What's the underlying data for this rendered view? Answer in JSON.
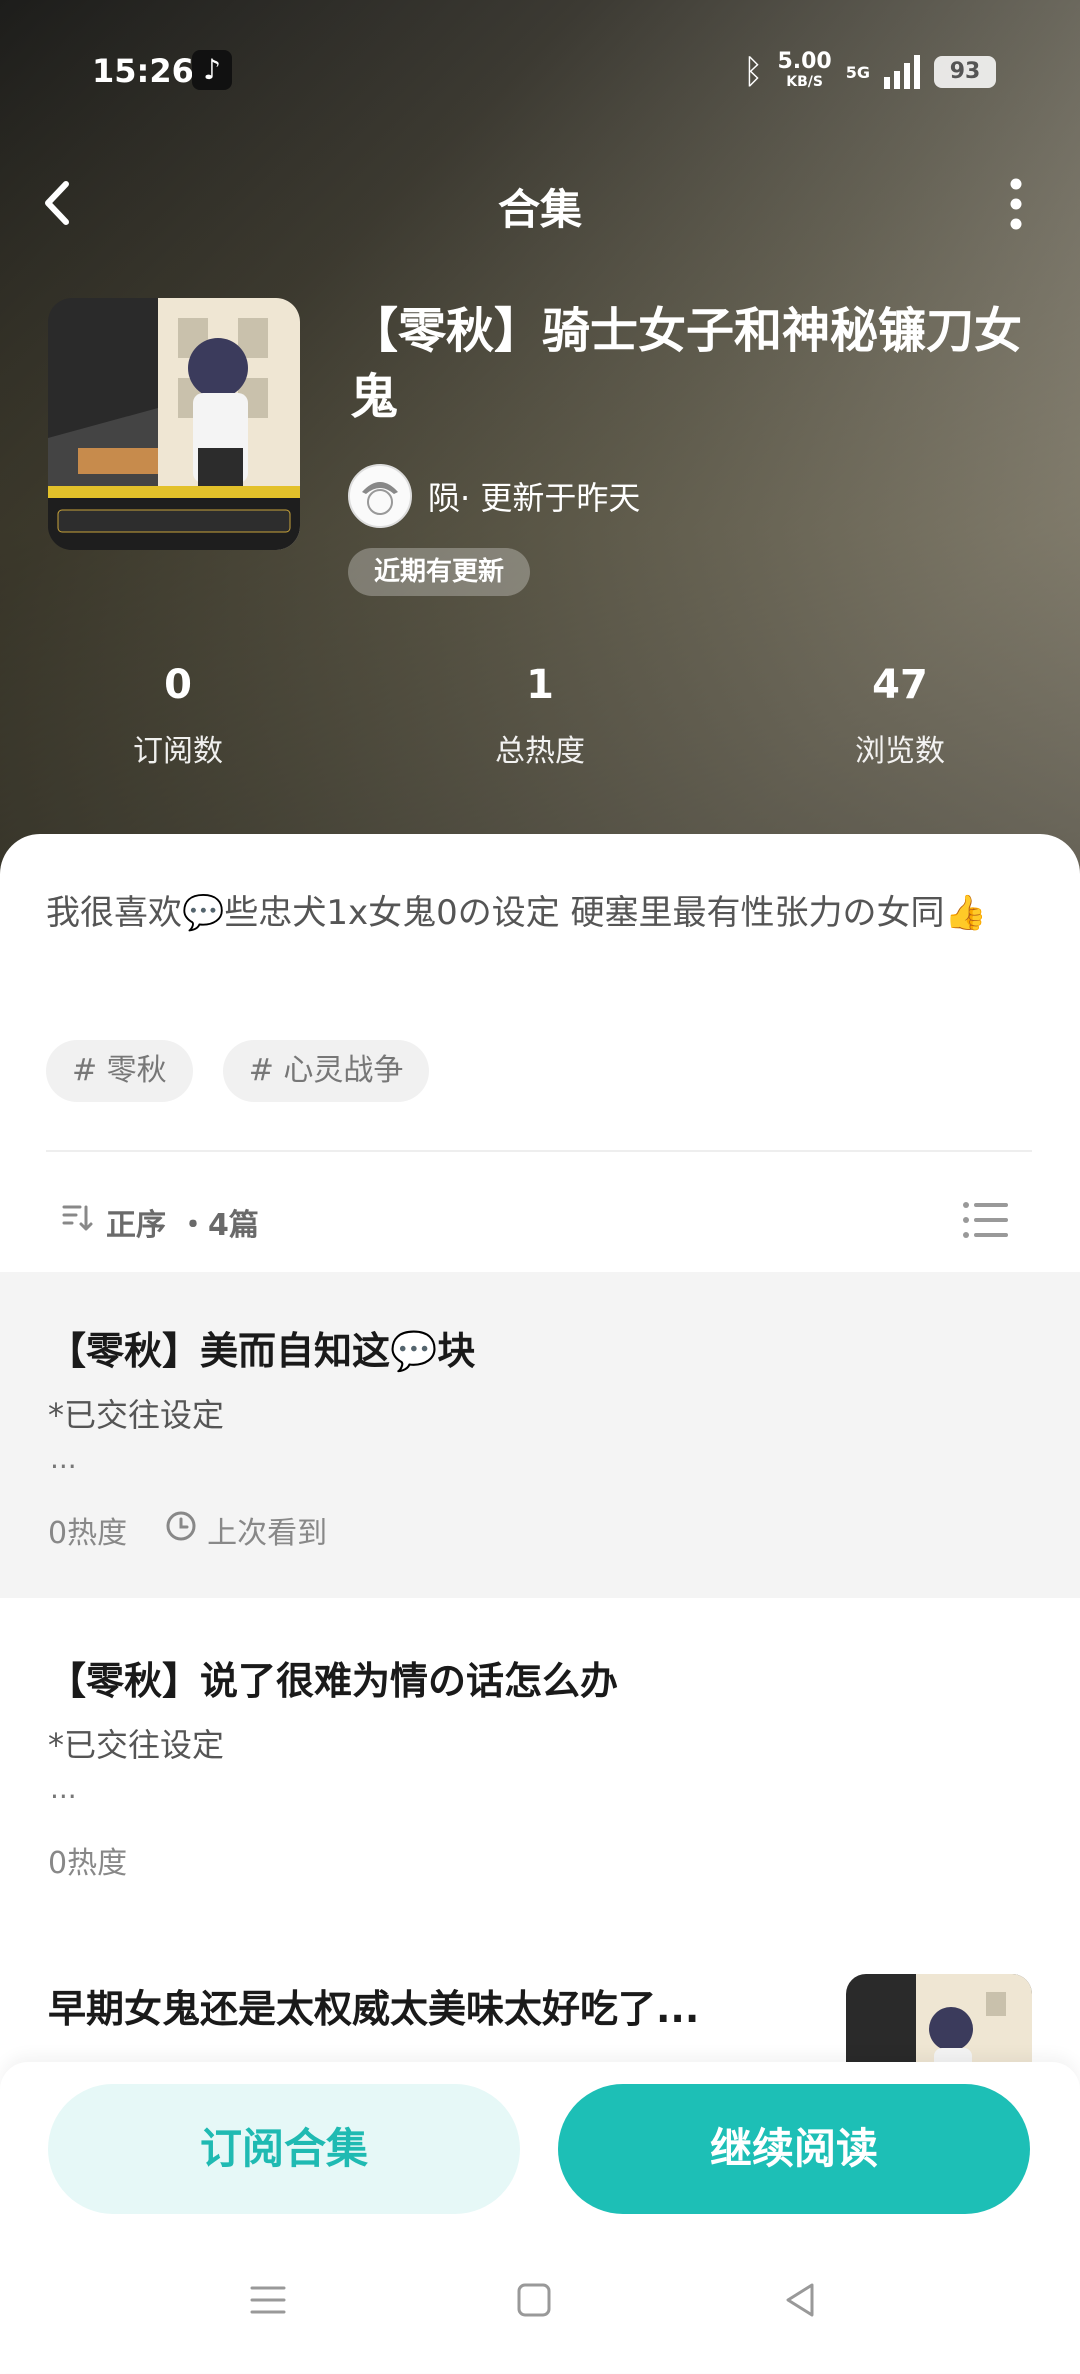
{
  "status_bar": {
    "time": "15:26",
    "speed_value": "5.00",
    "speed_unit": "KB/S",
    "network": "5G",
    "battery": "93"
  },
  "nav": {
    "title": "合集"
  },
  "collection": {
    "title": "【零秋】骑士女子和神秘镰刀女鬼",
    "author_line": "陨· 更新于昨天",
    "badge": "近期有更新",
    "stats": [
      {
        "value": "0",
        "label": "订阅数"
      },
      {
        "value": "1",
        "label": "总热度"
      },
      {
        "value": "47",
        "label": "浏览数"
      }
    ],
    "description": "我很喜欢💬些忠犬1x女鬼0の设定 硬塞里最有性张力の女同👍",
    "tags": [
      "# 零秋",
      "# 心灵战争"
    ]
  },
  "list_header": {
    "sort_label": "正序",
    "count_label": "・4篇"
  },
  "chapters": [
    {
      "title": "【零秋】美而自知这💬块",
      "subtitle": "*已交往设定",
      "ellipsis": "...",
      "heat": "0热度",
      "last_read": "上次看到"
    },
    {
      "title": "【零秋】说了很难为情の话怎么办",
      "subtitle": "*已交往设定",
      "ellipsis": "...",
      "heat": "0热度"
    },
    {
      "title": "早期女鬼还是太权威太美味太好吃了..."
    }
  ],
  "actions": {
    "subscribe": "订阅合集",
    "continue": "继续阅读"
  },
  "colors": {
    "accent": "#1dbfb6",
    "accent_light": "#e6f8f7"
  }
}
